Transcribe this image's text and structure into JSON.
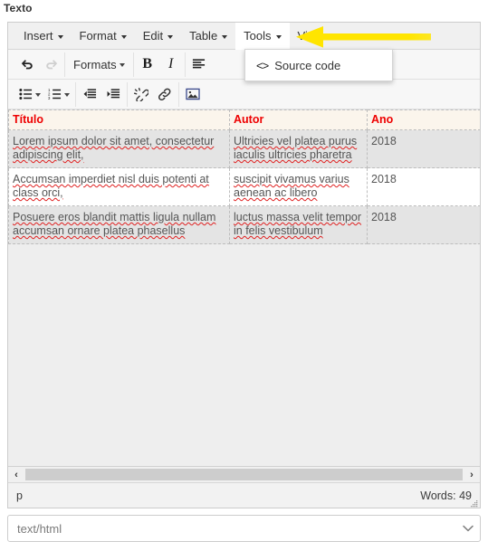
{
  "field": {
    "label": "Texto"
  },
  "menubar": {
    "items": [
      {
        "label": "Insert",
        "active": false
      },
      {
        "label": "Format",
        "active": false
      },
      {
        "label": "Edit",
        "active": false
      },
      {
        "label": "Table",
        "active": false
      },
      {
        "label": "Tools",
        "active": true
      },
      {
        "label": "View",
        "active": false
      }
    ]
  },
  "dropdown": {
    "open_for": "Tools",
    "items": [
      {
        "icon": "source-code-icon",
        "glyph": "<>",
        "label": "Source code"
      }
    ]
  },
  "toolbar_row1": {
    "undo": {
      "icon": "undo-icon",
      "title": "Undo"
    },
    "redo": {
      "icon": "redo-icon",
      "title": "Redo",
      "disabled": true
    },
    "formats": {
      "label": "Formats",
      "icon": "chevron-down-icon"
    },
    "bold": {
      "glyph": "B",
      "icon": "bold-icon"
    },
    "italic": {
      "glyph": "I",
      "icon": "italic-icon"
    },
    "align": {
      "icon": "align-left-icon"
    }
  },
  "toolbar_row2": {
    "bullist": {
      "icon": "unordered-list-icon"
    },
    "numlist": {
      "icon": "ordered-list-icon"
    },
    "outdent": {
      "icon": "outdent-icon"
    },
    "indent": {
      "icon": "indent-icon"
    },
    "unlink": {
      "icon": "unlink-icon"
    },
    "link": {
      "icon": "link-icon"
    },
    "image": {
      "icon": "image-icon"
    }
  },
  "table": {
    "headers": [
      "Título",
      "Autor",
      "Ano"
    ],
    "rows": [
      {
        "shaded": true,
        "cells": [
          "Lorem ipsum dolor sit amet, consectetur adipiscing elit,",
          "Ultricies vel platea purus iaculis ultricies pharetra",
          "2018"
        ]
      },
      {
        "shaded": false,
        "cells": [
          "Accumsan imperdiet nisl duis potenti at class orci,",
          "suscipit vivamus varius aenean ac libero",
          "2018"
        ]
      },
      {
        "shaded": true,
        "cells": [
          "Posuere eros blandit mattis ligula nullam accumsan ornare platea phasellus",
          " luctus massa velit tempor in felis vestibulum",
          "2018"
        ]
      }
    ]
  },
  "scrollbar": {
    "left_arrow": "‹",
    "right_arrow": "›"
  },
  "statusbar": {
    "path": "p",
    "words": "Words: 49"
  },
  "mime_select": {
    "value": "text/html",
    "icon": "chevron-down-icon"
  },
  "annotation": {
    "type": "arrow",
    "direction": "left",
    "color": "#FFE500",
    "points_to": "Tools"
  },
  "colors": {
    "header_text": "#ee0000",
    "header_bg": "#fbf5ec",
    "row_shade": "#e4e4e4",
    "body_bg": "#eeeeee",
    "arrow": "#FFE500",
    "spellcheck": "#e02020"
  }
}
